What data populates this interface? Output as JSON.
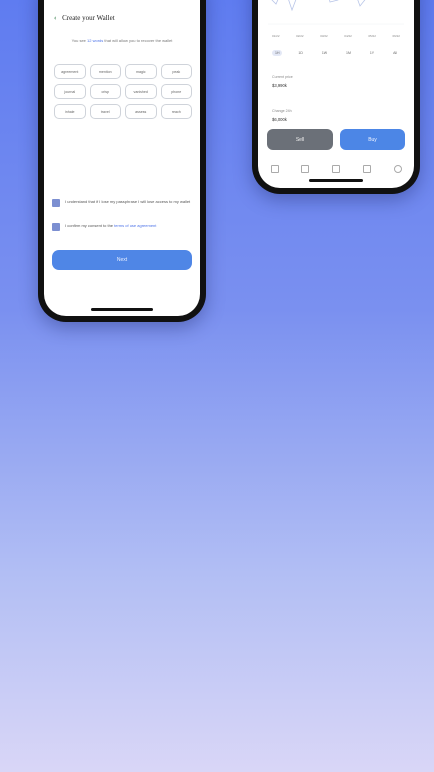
{
  "left_phone": {
    "header": {
      "back_icon": "chevron-left-icon",
      "title": "Create your Wallet"
    },
    "hint": {
      "before": "You see ",
      "highlight": "12 words",
      "after": " that will allow you to recover the wallet"
    },
    "words": [
      "agreement",
      "mention",
      "magic",
      "peak",
      "journal",
      "crisp",
      "vanished",
      "phone",
      "inhale",
      "travel",
      "assess",
      "reach"
    ],
    "checks": [
      {
        "text": "I understand that if I lose my passphrase I will lose access to my wallet",
        "link": ""
      },
      {
        "text": "I confirm my consent to the ",
        "link": "terms of use agreement"
      }
    ],
    "next_label": "Next"
  },
  "right_phone": {
    "x_labels": [
      "01/22",
      "02/22",
      "03/22",
      "04/22",
      "05/22",
      "06/22"
    ],
    "periods": [
      "1H",
      "1D",
      "1W",
      "1M",
      "1Y",
      "All"
    ],
    "selected_period": "1H",
    "stats": [
      {
        "label": "Current price",
        "value": "$3,990k"
      },
      {
        "label": "Change 24h",
        "value": "$6,000k"
      },
      {
        "label": "Low 24h",
        "value": ""
      }
    ],
    "sell_label": "Sell",
    "buy_label": "Buy",
    "tabs": [
      "home-icon",
      "chart-icon",
      "wallet-icon",
      "history-icon",
      "settings-icon"
    ]
  },
  "colors": {
    "accent": "#4f86e6",
    "sell": "#6b7078",
    "checkbox": "#7c8fd1",
    "header_back": "#2f7a45"
  }
}
